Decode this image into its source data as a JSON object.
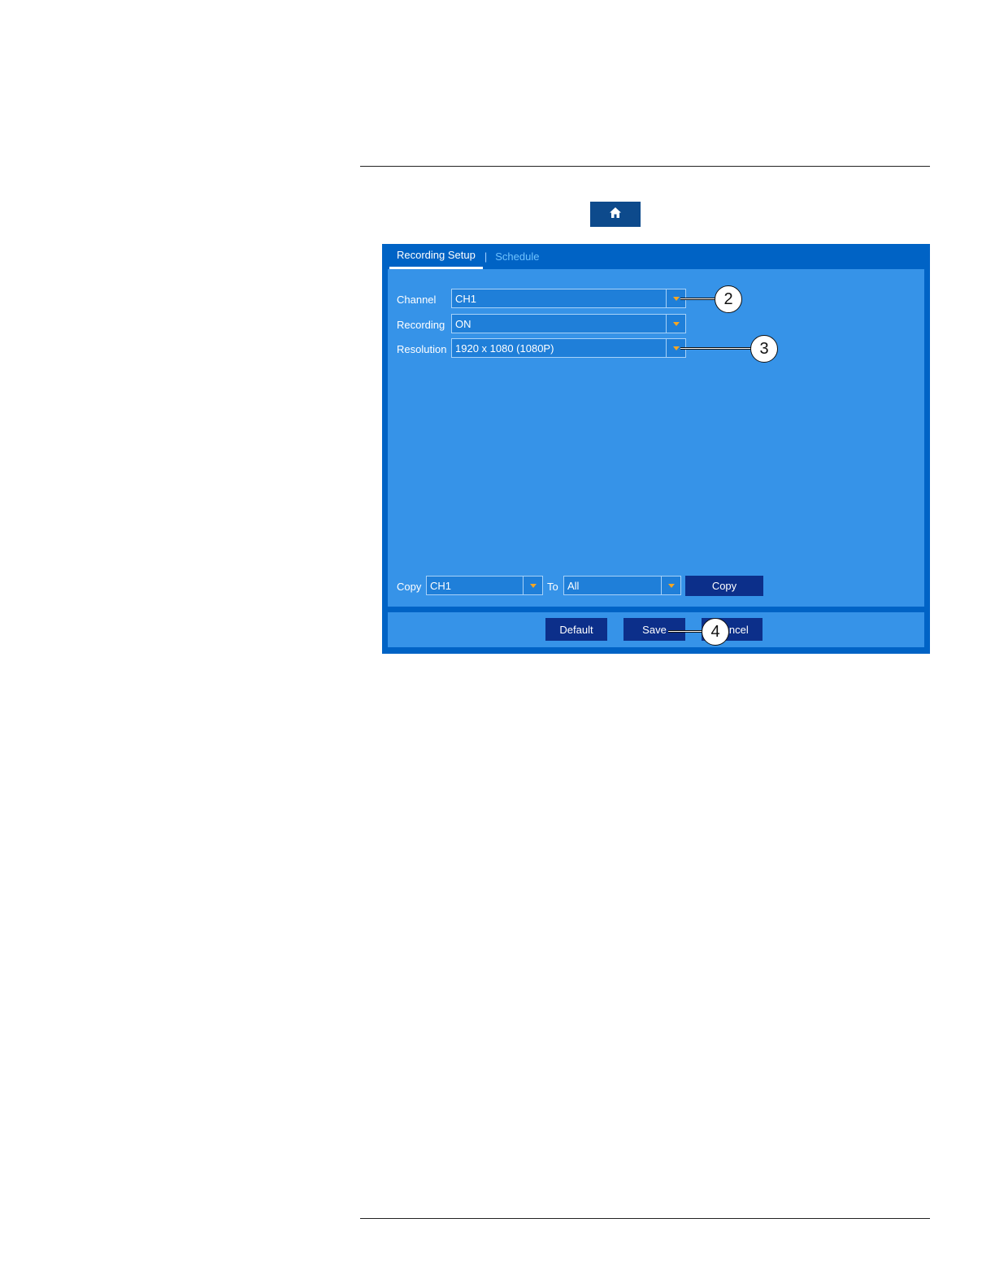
{
  "home": {
    "icon": "home-icon"
  },
  "tabs": {
    "active": "Recording Setup",
    "separator": "|",
    "inactive": "Schedule"
  },
  "fields": {
    "channel": {
      "label": "Channel",
      "value": "CH1"
    },
    "recording": {
      "label": "Recording",
      "value": "ON"
    },
    "resolution": {
      "label": "Resolution",
      "value": "1920 x 1080 (1080P)"
    }
  },
  "copy_row": {
    "label": "Copy",
    "from_value": "CH1",
    "to_label": "To",
    "to_value": "All",
    "button": "Copy"
  },
  "footer": {
    "default": "Default",
    "save": "Save",
    "cancel": "Cancel"
  },
  "callouts": {
    "channel": "2",
    "resolution": "3",
    "save": "4"
  },
  "colors": {
    "panel_dark": "#0063c5",
    "panel_light": "#3693e8",
    "button": "#0c2f8a",
    "arrow": "#f5a623"
  }
}
